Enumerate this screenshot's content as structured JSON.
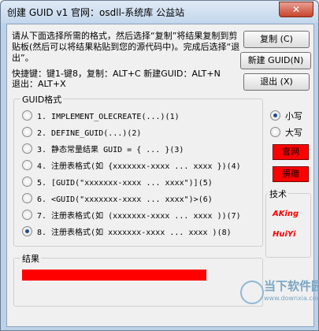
{
  "window": {
    "title": "创建 GUID v1  官网：osdll-系统库 公益站",
    "close_label": "✕"
  },
  "instructions": "请从下面选择所需的格式，然后选择“复制”将结果复制到剪贴板(然后可以将结果粘贴到您的源代码中)。完成后选择“退出”。",
  "buttons": {
    "copy": "复制 (C)",
    "new_guid": "新建 GUID(N)",
    "exit": "退出 (X)"
  },
  "shortcuts": {
    "line1": "快捷键：键1-键8，复制：ALT+C   新建GUID：ALT+N",
    "line2": "退出：ALT+X"
  },
  "format_group": {
    "title": "GUID格式",
    "selected_index": 8,
    "options": [
      "1. IMPLEMENT_OLECREATE(...)(1)",
      "2. DEFINE_GUID(...)(2)",
      "3. 静态常量结果 GUID = { ... }(3)",
      "4. 注册表格式(如 {xxxxxxx-xxxx ... xxxx })(4)",
      "5. [GUID(\"xxxxxxx-xxxx ... xxxx\")](5)",
      "6. <GUID(\"xxxxxxx-xxxx ... xxxx\")>(6)",
      "7. 注册表格式(如 (xxxxxxx-xxxx ... xxxx ))(7)",
      "8. 注册表格式(如 xxxxxxx-xxxx ... xxxx )(8)"
    ]
  },
  "case": {
    "lower": "小写",
    "upper": "大写",
    "selected": "lower"
  },
  "links": {
    "website": "官网",
    "donate": "捐赠"
  },
  "author_group": {
    "title": "技术",
    "names": [
      "AKing",
      "HuiYi"
    ]
  },
  "result_group": {
    "title": "结果"
  },
  "watermark": {
    "name": "当下软件园",
    "url": "www.downxia.com"
  },
  "colors": {
    "highlight_red": "#ff0000",
    "radio_dot": "#1d4e8f"
  }
}
